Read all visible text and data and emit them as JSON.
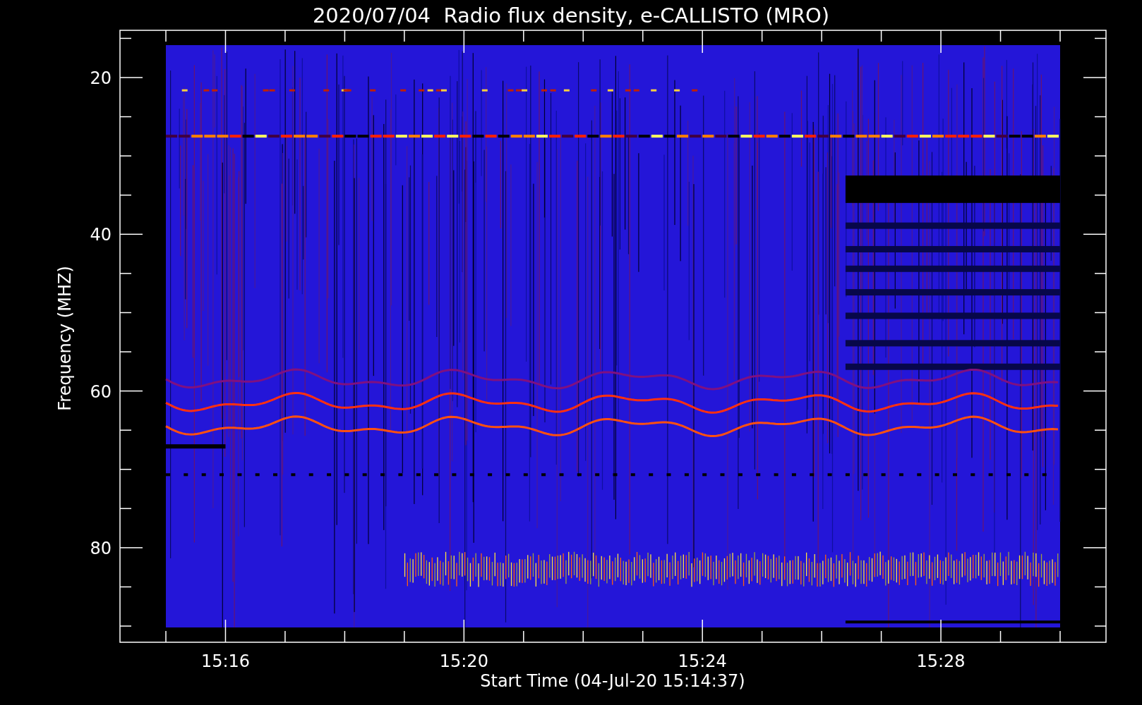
{
  "title": "2020/07/04  Radio flux density, e-CALLISTO (MRO)",
  "y_axis": {
    "label": "Frequency (MHZ)",
    "tick_labels": [
      "20",
      "40",
      "60",
      "80"
    ]
  },
  "x_axis": {
    "label": "Start Time (04-Jul-20 15:14:37)",
    "tick_labels": [
      "15:16",
      "15:20",
      "15:24",
      "15:28"
    ]
  }
}
